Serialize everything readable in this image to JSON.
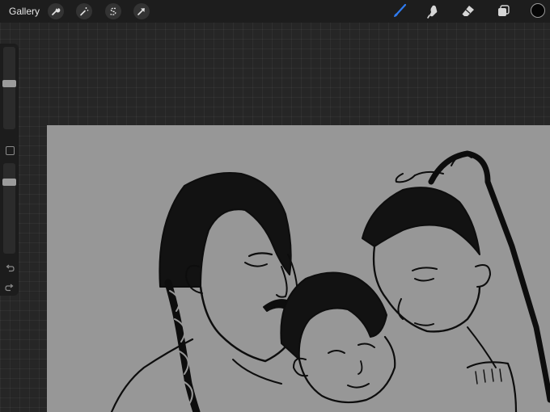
{
  "topbar": {
    "gallery_label": "Gallery",
    "left_tools": [
      "wrench-icon",
      "magic-wand-icon",
      "selection-s-icon",
      "transform-arrow-icon"
    ],
    "right_tools": [
      "brush-icon",
      "smudge-icon",
      "eraser-icon",
      "layers-icon"
    ],
    "active_tool": "brush-icon",
    "accent_color": "#2f7bf0",
    "current_color": "#050505"
  },
  "sidebar": {
    "brush_size_level": 0.44,
    "opacity_level": 0.18,
    "buttons": [
      "modifier-square-icon",
      "undo-icon",
      "redo-icon"
    ]
  },
  "canvas": {
    "background": "#979797",
    "content": "line-art-sketch"
  }
}
